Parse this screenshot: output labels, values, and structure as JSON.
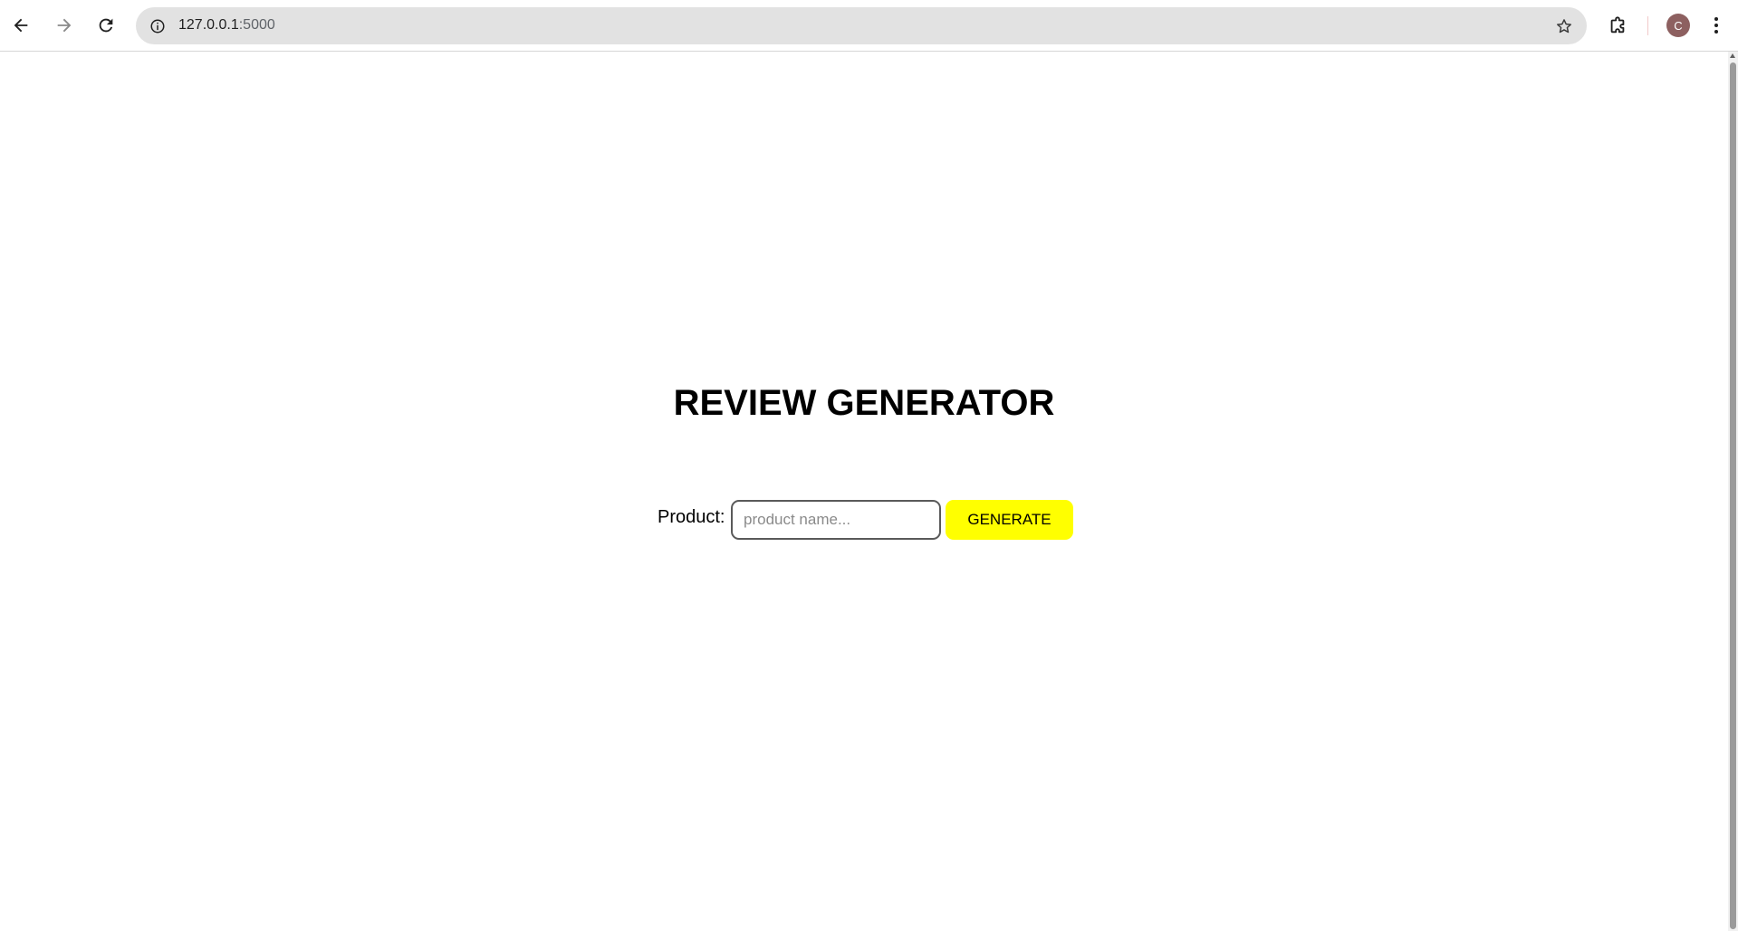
{
  "browser": {
    "url_host": "127.0.0.1",
    "url_port": ":5000",
    "profile_initial": "C",
    "icons": {
      "back": "back-arrow-icon",
      "forward": "forward-arrow-icon",
      "reload": "reload-icon",
      "site_info": "info-icon",
      "bookmark": "star-icon",
      "extensions": "puzzle-piece-icon",
      "menu": "kebab-menu-icon"
    },
    "colors": {
      "omnibox_bg": "#e2e2e2",
      "avatar_bg": "#8d6060"
    }
  },
  "page": {
    "title": "REVIEW GENERATOR",
    "form": {
      "label": "Product:",
      "input_value": "",
      "input_placeholder": "product name...",
      "button_label": "GENERATE"
    },
    "colors": {
      "button_bg": "#ffff00",
      "text": "#000000"
    }
  }
}
